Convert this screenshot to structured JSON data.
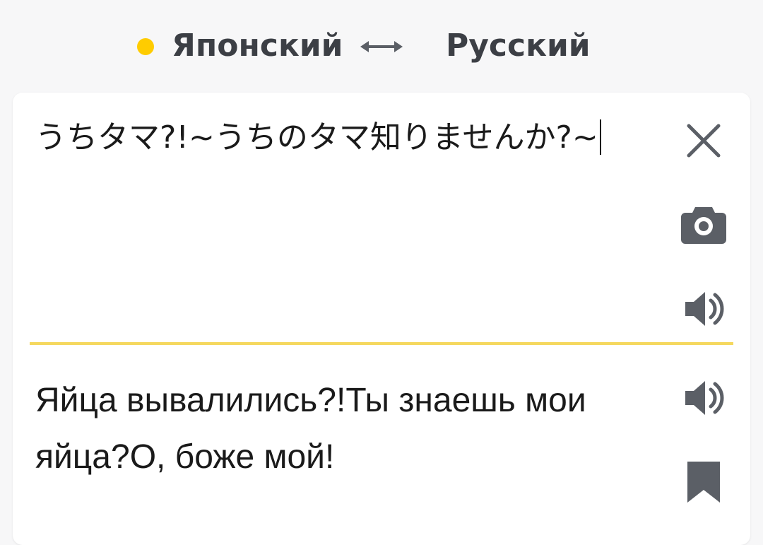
{
  "colors": {
    "accent": "#ffcc00",
    "divider": "#f5d85e",
    "icon": "#5b5f66",
    "text": "#1a1a1a"
  },
  "languages": {
    "source": "Японский",
    "target": "Русский",
    "swap_icon": "swap-arrows-icon"
  },
  "source": {
    "text": "うちタマ?!~うちのタマ知りませんか?~",
    "icons": [
      "close-icon",
      "camera-icon",
      "speaker-icon"
    ]
  },
  "translation": {
    "text": "Яйца вывалились?!Ты знаешь мои яйца?О, боже мой!",
    "icons": [
      "speaker-icon",
      "bookmark-icon"
    ]
  }
}
